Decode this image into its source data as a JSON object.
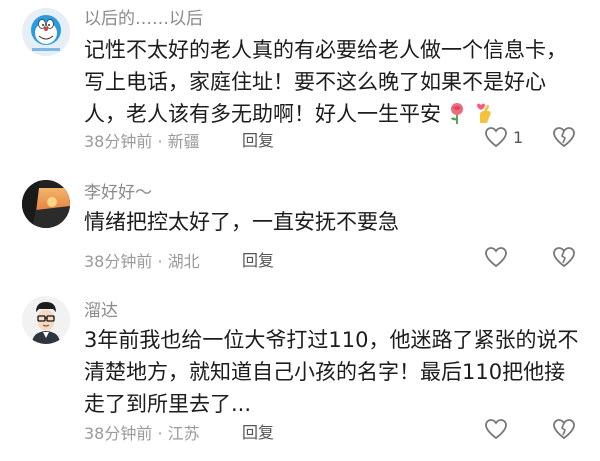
{
  "comments": [
    {
      "username": "以后的……以后",
      "text": "记性不太好的老人真的有必要给老人做一个信息卡，写上电话，家庭住址！要不这么晚了如果不是好心人，老人该有多无助啊！好人一生平安",
      "time": "38分钟前",
      "location": "新疆",
      "reply_label": "回复",
      "likes": "1",
      "avatar_icon": "doraemon-avatar-icon"
    },
    {
      "username": "李好好～",
      "text": "情绪把控太好了，一直安抚不要急",
      "time": "38分钟前",
      "location": "湖北",
      "reply_label": "回复",
      "avatar_icon": "sunset-car-avatar-icon"
    },
    {
      "username": "溜达",
      "text": "3年前我也给一位大爷打过110，他迷路了紧张的说不清楚地方，就知道自己小孩的名字！最后110把他接走了到所里去了...",
      "time": "38分钟前",
      "location": "江苏",
      "reply_label": "回复",
      "avatar_icon": "cartoon-man-avatar-icon"
    }
  ],
  "colors": {
    "meta": "#9a9a9a",
    "name": "#8a8a8a",
    "text": "#1c1c1c"
  }
}
